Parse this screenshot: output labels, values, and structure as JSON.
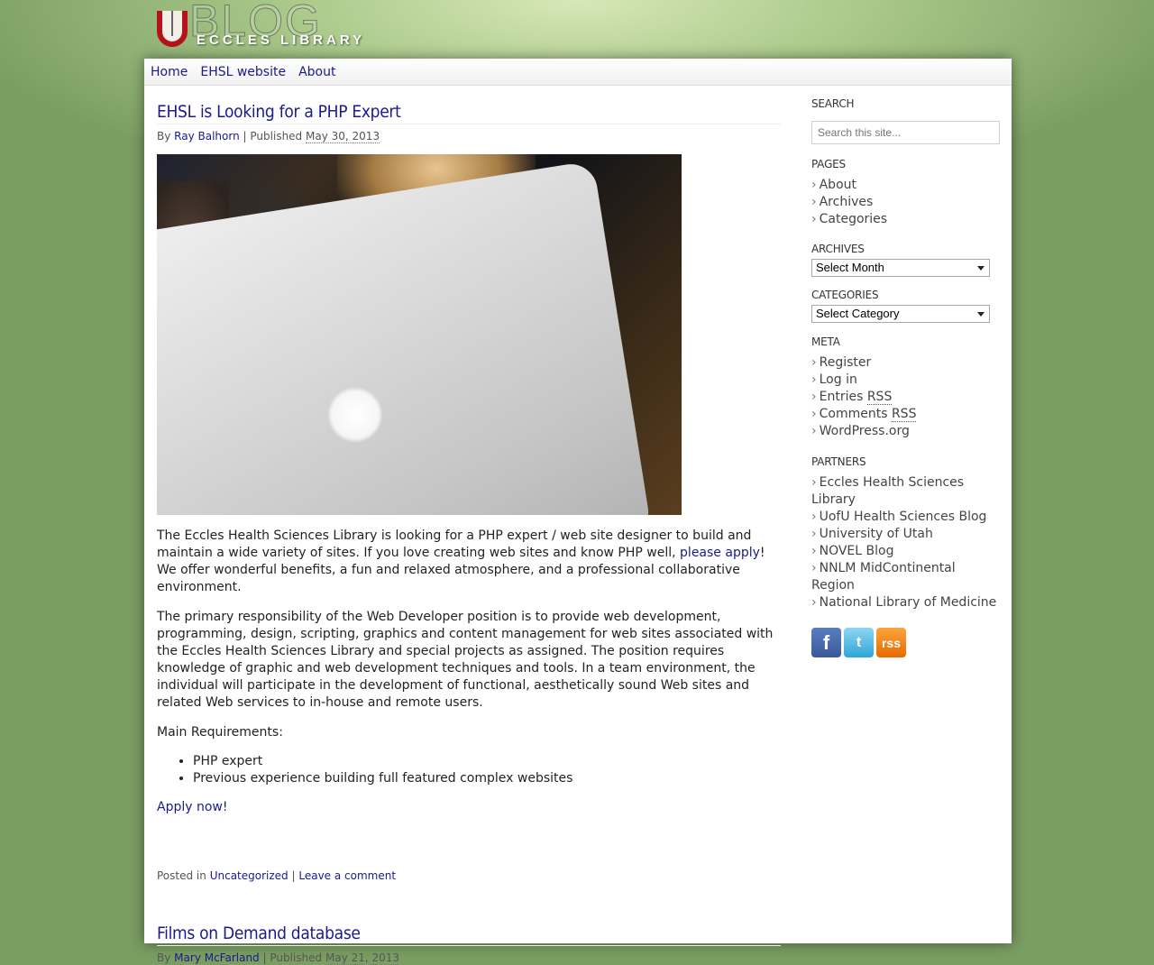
{
  "header": {
    "logo_big": "BLOG",
    "logo_small": "ECCLES LIBRARY"
  },
  "nav": {
    "items": [
      "Home",
      "EHSL website",
      "About"
    ]
  },
  "posts": [
    {
      "title": "EHSL is Looking for a PHP Expert",
      "by_label": "By",
      "author": "Ray Balhorn",
      "published_label": "| Published",
      "date": "May 30, 2013",
      "p1_before": "The Eccles Health Sciences Library is looking for a PHP expert / web site designer to build and maintain a wide variety of sites.  If you love creating web sites and know PHP well, ",
      "p1_link": "please apply",
      "p1_after": "!  We offer wonderful benefits, a fun and relaxed atmosphere, and a professional collaborative environment.",
      "p2": "The primary responsibility of the Web Developer position is to provide web development, programming, design, scripting, graphics and content management for web sites associated with the Eccles Health Sciences Library and special projects as assigned. The position requires knowledge of graphic and web development techniques and tools. In a team environment, the individual will participate in the development of functional, aesthetically sound Web sites and related Web services to in-house and remote users.",
      "p3": "Main Requirements:",
      "requirements": [
        "PHP expert",
        "Previous experience building full featured complex websites"
      ],
      "apply_link": "Apply now!",
      "posted_in_label": "Posted in",
      "category": "Uncategorized",
      "separator": "|",
      "comment_link": "Leave a comment"
    },
    {
      "title": "Films on Demand database",
      "by_label": "By",
      "author": "Mary McFarland",
      "published_label": "| Published",
      "date": "May 21, 2013"
    }
  ],
  "sidebar": {
    "search": {
      "title": "SEARCH",
      "placeholder": "Search this site..."
    },
    "pages": {
      "title": "PAGES",
      "items": [
        "About",
        "Archives",
        "Categories"
      ]
    },
    "archives": {
      "title": "ARCHIVES",
      "selected": "Select Month"
    },
    "categories": {
      "title": "CATEGORIES",
      "selected": "Select Category"
    },
    "meta": {
      "title": "META",
      "items": [
        "Register",
        "Log in",
        "Entries",
        "Comments",
        "WordPress.org"
      ],
      "rss": "RSS"
    },
    "partners": {
      "title": "PARTNERS",
      "items": [
        "Eccles Health Sciences Library",
        "UofU Health Sciences Blog",
        "University of Utah",
        "NOVEL Blog",
        "NNLM MidContinental Region",
        "National Library of Medicine"
      ]
    },
    "social": {
      "icons": [
        "facebook-icon",
        "twitter-icon",
        "rss-icon"
      ],
      "glyphs": [
        "f",
        "t",
        "rss"
      ]
    }
  },
  "list_arrow": "›"
}
